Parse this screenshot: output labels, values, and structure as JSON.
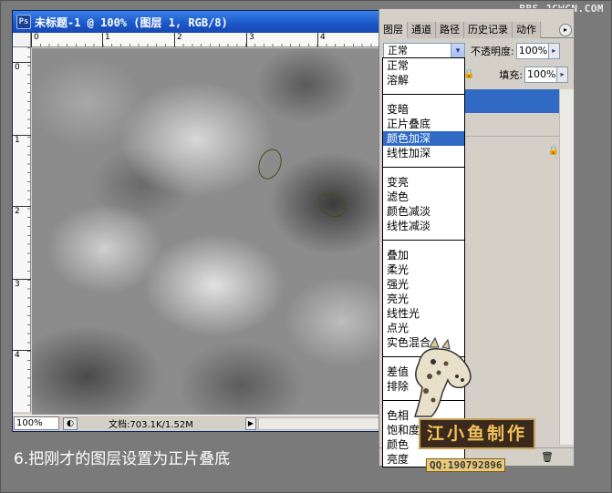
{
  "watermark": "BBS.JCWCN.COM",
  "document": {
    "title": "未标题-1 @ 100% (图层 1, RGB/8)",
    "ps_icon": "Ps",
    "ruler_h_labels": [
      "0",
      "1",
      "2",
      "3",
      "4"
    ],
    "ruler_v_labels": [
      "0",
      "1",
      "2",
      "3",
      "4"
    ],
    "zoom": "100%",
    "doc_info": "文档:703.1K/1.52M",
    "status_icon": "navigator-icon",
    "status_arrow": "▶"
  },
  "layers_panel": {
    "tabs": [
      "图层",
      "通道",
      "路径",
      "历史记录",
      "动作"
    ],
    "menu_button": "▸",
    "blend_mode": "正常",
    "blend_arrow": "▾",
    "opacity_label": "不透明度:",
    "opacity_value": "100%",
    "fill_label": "填充:",
    "fill_value": "100%",
    "lock_icon": "🔒",
    "trash_icon": "🗑",
    "spinner_arrow": "▸"
  },
  "blend_menu": {
    "groups": [
      [
        "正常",
        "溶解"
      ],
      [
        "变暗",
        "正片叠底",
        "颜色加深",
        "线性加深"
      ],
      [
        "变亮",
        "滤色",
        "颜色减淡",
        "线性减淡"
      ],
      [
        "叠加",
        "柔光",
        "强光",
        "亮光",
        "线性光",
        "点光",
        "实色混合"
      ],
      [
        "差值",
        "排除"
      ],
      [
        "色相",
        "饱和度",
        "颜色",
        "亮度"
      ]
    ],
    "highlighted": "颜色加深"
  },
  "caption": "6.把刚才的图层设置为正片叠底",
  "logo_text": "江小鱼制作",
  "qq_text": "QQ:190792896"
}
